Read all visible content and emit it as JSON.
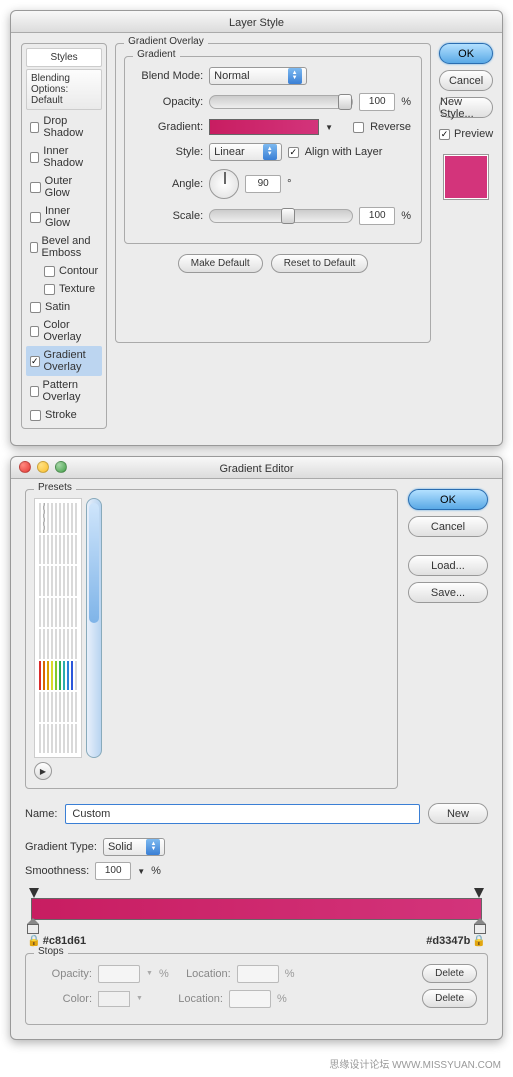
{
  "layerStyle": {
    "title": "Layer Style",
    "stylesHeader": "Styles",
    "blendingOptions": "Blending Options: Default",
    "items": [
      {
        "label": "Drop Shadow",
        "checked": false
      },
      {
        "label": "Inner Shadow",
        "checked": false
      },
      {
        "label": "Outer Glow",
        "checked": false
      },
      {
        "label": "Inner Glow",
        "checked": false
      },
      {
        "label": "Bevel and Emboss",
        "checked": false
      },
      {
        "label": "Contour",
        "checked": false,
        "indent": true
      },
      {
        "label": "Texture",
        "checked": false,
        "indent": true
      },
      {
        "label": "Satin",
        "checked": false
      },
      {
        "label": "Color Overlay",
        "checked": false
      },
      {
        "label": "Gradient Overlay",
        "checked": true,
        "selected": true
      },
      {
        "label": "Pattern Overlay",
        "checked": false
      },
      {
        "label": "Stroke",
        "checked": false
      }
    ],
    "groupTitle": "Gradient Overlay",
    "innerTitle": "Gradient",
    "blendModeLabel": "Blend Mode:",
    "blendModeValue": "Normal",
    "opacityLabel": "Opacity:",
    "opacityValue": "100",
    "pct": "%",
    "gradientLabel": "Gradient:",
    "reverseLabel": "Reverse",
    "styleLabel": "Style:",
    "styleValue": "Linear",
    "alignLabel": "Align with Layer",
    "angleLabel": "Angle:",
    "angleValue": "90",
    "deg": "°",
    "scaleLabel": "Scale:",
    "scaleValue": "100",
    "makeDefault": "Make Default",
    "resetDefault": "Reset to Default",
    "ok": "OK",
    "cancel": "Cancel",
    "newStyle": "New Style...",
    "preview": "Preview",
    "previewColor": "#d3347b"
  },
  "gradEditor": {
    "title": "Gradient Editor",
    "presetsLabel": "Presets",
    "ok": "OK",
    "cancel": "Cancel",
    "load": "Load...",
    "save": "Save...",
    "nameLabel": "Name:",
    "nameValue": "Custom",
    "new": "New",
    "gradTypeLabel": "Gradient Type:",
    "gradTypeValue": "Solid",
    "smoothLabel": "Smoothness:",
    "smoothValue": "100",
    "pct": "%",
    "hexLeft": "#c81d61",
    "hexRight": "#d3347b",
    "stopsLabel": "Stops",
    "opacityLabel": "Opacity:",
    "colorLabel": "Color:",
    "locationLabel": "Location:",
    "delete": "Delete",
    "presets": [
      "linear-gradient(#000,#fff)",
      "repeating-conic-gradient(#ccc 0 25%,#fff 0 50%) 0/8px 8px",
      "linear-gradient(#000,#fff,#000)",
      "linear-gradient(90deg,red,orange,yellow,green,blue,violet)",
      "linear-gradient(#f80,#ff0,#f80)",
      "linear-gradient(#e0c080,#8b5a2b)",
      "linear-gradient(45deg,#000 25%,#fff 25% 50%,#000 50% 75%,#fff 75%)",
      "linear-gradient(#8cf,#06c)",
      "linear-gradient(#5a8,#fff,#5a8)",
      "linear-gradient(#666,#eee)",
      "linear-gradient(#888,#222,#888)",
      "linear-gradient(#ccc,#555)",
      "linear-gradient(#06c,#039)",
      "linear-gradient(#036,#000)",
      "linear-gradient(#f7c,#a05)",
      "linear-gradient(#909,#303)",
      "linear-gradient(#fa0,#c60)",
      "linear-gradient(#0c0,#060)",
      "linear-gradient(#aaa,#333,#aaa)",
      "linear-gradient(#c96,#630)",
      "linear-gradient(#ddd,#888)",
      "linear-gradient(#bbb,#fff,#bbb)",
      "linear-gradient(#9cf,#fff)",
      "linear-gradient(#ccc,#fff,#999)",
      "linear-gradient(#ddd,#aaa)",
      "linear-gradient(#fff,#ccc)",
      "linear-gradient(#e0e0e0,#909090)",
      "linear-gradient(#f5f5f5,#bbb)",
      "linear-gradient(#ccc,#fff)",
      "linear-gradient(#aaa,#eee,#aaa)",
      "linear-gradient(#ccc,#666)",
      "linear-gradient(45deg,#f00,#ff0)",
      "linear-gradient(#fff,#eee)",
      "linear-gradient(#555,#999,#555)",
      "linear-gradient(#222,#777)",
      "linear-gradient(#888,#ddd)",
      "linear-gradient(#999,#eee,#999)",
      "linear-gradient(#aaa,#fff)",
      "linear-gradient(#777,#bbb)",
      "linear-gradient(#999,#ccc)",
      "linear-gradient(#ff0,#f80)",
      "linear-gradient(#f44,#fcc)",
      "linear-gradient(#f0f,#fbf)",
      "linear-gradient(#80f,#d8f)",
      "linear-gradient(#06f,#9cf)",
      "linear-gradient(#0cc,#9ee)",
      "linear-gradient(#0c4,#9e9)",
      "linear-gradient(#8c0,#ce8)",
      "linear-gradient(#cc0,#ee8)",
      "linear-gradient(#fff,#fff)",
      "#f33",
      "#f70",
      "#fb0",
      "#ff3",
      "#9e3",
      "#3c6",
      "#3cc",
      "#39f",
      "#36f",
      "#fff",
      "linear-gradient(90deg,#a0a,#f0f)",
      "linear-gradient(90deg,#960,#fc6)",
      "linear-gradient(90deg,#080,#5d5)",
      "linear-gradient(90deg,#46a,#ace)",
      "linear-gradient(90deg,#c06,#f6a)",
      "linear-gradient(90deg,#666,#ccc)",
      "linear-gradient(90deg,#393,#9d9)",
      "linear-gradient(90deg,#933,#e99)",
      "linear-gradient(90deg,#339,#99e)",
      "linear-gradient(90deg,#aaa,#fff)",
      "linear-gradient(#f99,#fff)",
      "linear-gradient(#6c3,#fff)",
      "linear-gradient(#9f6,#fff)",
      "linear-gradient(#9cf,#fff)",
      "linear-gradient(#f9f,#fff)",
      "linear-gradient(#c9f,#fff)",
      "linear-gradient(#ff9,#fff)",
      "linear-gradient(#f6c,#fff)",
      "linear-gradient(#6cf,#fff)",
      "linear-gradient(#ccc,#fff)"
    ]
  },
  "footer": "思缘设计论坛   WWW.MISSYUAN.COM"
}
